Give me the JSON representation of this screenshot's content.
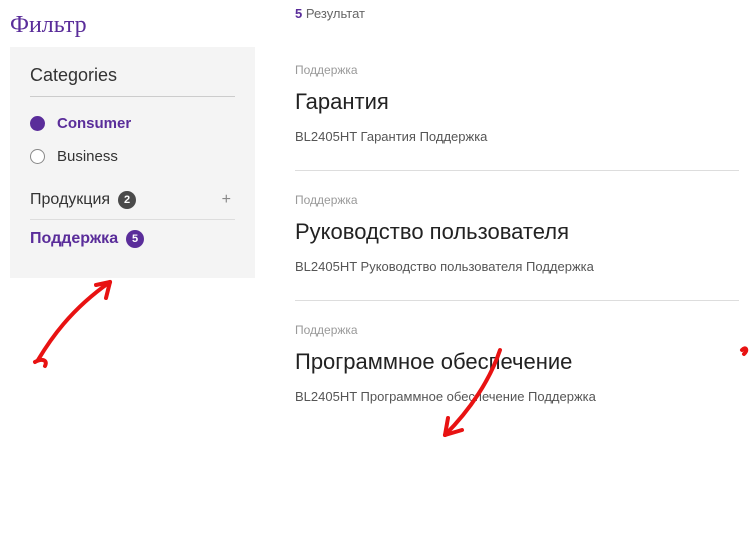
{
  "sidebar": {
    "title": "Фильтр",
    "categories_heading": "Categories",
    "radios": [
      {
        "label": "Consumer",
        "selected": true
      },
      {
        "label": "Business",
        "selected": false
      }
    ],
    "facets": [
      {
        "label": "Продукция",
        "count": "2",
        "active": false,
        "expandable": true
      },
      {
        "label": "Поддержка",
        "count": "5",
        "active": true,
        "expandable": false
      }
    ]
  },
  "results": {
    "count_number": "5",
    "count_label": "Результат",
    "items": [
      {
        "category": "Поддержка",
        "title": "Гарантия",
        "desc": "BL2405HT Гарантия Поддержка"
      },
      {
        "category": "Поддержка",
        "title": "Руководство пользователя",
        "desc": "BL2405HT Руководство пользователя Поддержка"
      },
      {
        "category": "Поддержка",
        "title": "Программное обеспечение",
        "desc": "BL2405HT Программное обеспечение Поддержка"
      }
    ]
  },
  "icons": {
    "plus": "+"
  }
}
